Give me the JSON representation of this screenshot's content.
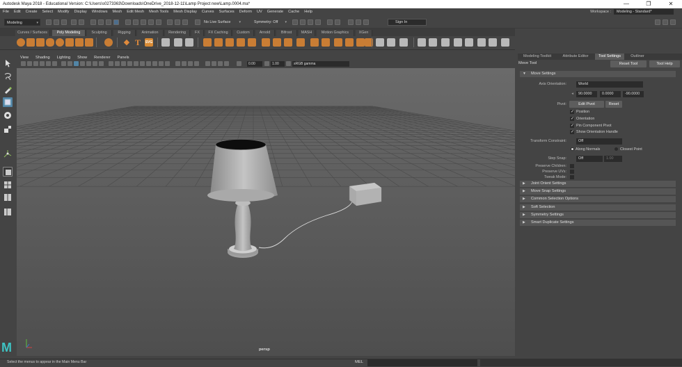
{
  "window": {
    "title": "Autodesk Maya 2018 - Educational Version: C:\\Users\\s0273363\\Downloads\\OneDrive_2018-12-11\\Lamp Project new\\Lamp.0004.ma*",
    "controls": [
      "—",
      "❐",
      "✕"
    ]
  },
  "menubar": {
    "items": [
      "File",
      "Edit",
      "Create",
      "Select",
      "Modify",
      "Display",
      "Windows",
      "Mesh",
      "Edit Mesh",
      "Mesh Tools",
      "Mesh Display",
      "Curves",
      "Surfaces",
      "Deform",
      "UV",
      "Generate",
      "Cache",
      "Help"
    ]
  },
  "workspace": {
    "label": "Workspace :",
    "value": "Modeling - Standard*"
  },
  "statusline": {
    "menuset": "Modeling",
    "live_surface": "No Live Surface",
    "symmetry": "Symmetry: Off",
    "signin": "Sign In"
  },
  "shelf_tabs": [
    "Curves / Surfaces",
    "Poly Modeling",
    "Sculpting",
    "Rigging",
    "Animation",
    "Rendering",
    "FX",
    "FX Caching",
    "Custom",
    "Arnold",
    "Bifrost",
    "MASH",
    "Motion Graphics",
    "XGen"
  ],
  "shelf_active": "Poly Modeling",
  "shelf_icons": {
    "text_tool": "T",
    "svg_tool": "SVG"
  },
  "viewport": {
    "menu": [
      "View",
      "Shading",
      "Lighting",
      "Show",
      "Renderer",
      "Panels"
    ],
    "near_value": "0.00",
    "far_value": "1.00",
    "colorspace": "sRGB gamma",
    "camera_label": "persp"
  },
  "right_panel": {
    "tabs": [
      "Modeling Toolkit",
      "Attribute Editor",
      "Tool Settings",
      "Outliner"
    ],
    "active_tab": "Tool Settings",
    "tool_name": "Move Tool",
    "reset_tool": "Reset Tool",
    "tool_help": "Tool Help",
    "move_settings": {
      "header": "Move Settings",
      "axis_orientation_label": "Axis Orientation:",
      "axis_orientation_value": "World",
      "axis_values": [
        "90.0000",
        "0.0000",
        "-90.0000"
      ],
      "pivot_label": "Pivot:",
      "edit_pivot": "Edit Pivot",
      "reset": "Reset",
      "pivot_options": [
        {
          "label": "Position",
          "checked": true
        },
        {
          "label": "Orientation",
          "checked": true
        },
        {
          "label": "Pin Component Pivot",
          "checked": true
        },
        {
          "label": "Show Orientation Handle",
          "checked": true
        }
      ],
      "transform_constraint_label": "Transform Constraint:",
      "transform_constraint_value": "Off",
      "along_normals": "Along Normals",
      "closest_point": "Closest Point",
      "step_snap_label": "Step Snap:",
      "step_snap_value": "Off",
      "step_snap_amount": "1.00",
      "preserve_children": "Preserve Children:",
      "preserve_uvs": "Preserve UVs:",
      "tweak_mode": "Tweak Mode:"
    },
    "collapsed_sections": [
      "Joint Orient Settings",
      "Move Snap Settings",
      "Common Selection Options",
      "Soft Selection",
      "Symmetry Settings",
      "Smart Duplicate Settings"
    ]
  },
  "helpline": {
    "text": "Select the menus to appear in the Main Menu Bar",
    "mel_label": "MEL"
  },
  "logo": "M",
  "colors": {
    "accent": "#5285a6",
    "shelf_orange": "#c97d34",
    "viewport_bg": "#5d5d5d",
    "grid": "#4a4a4a"
  }
}
